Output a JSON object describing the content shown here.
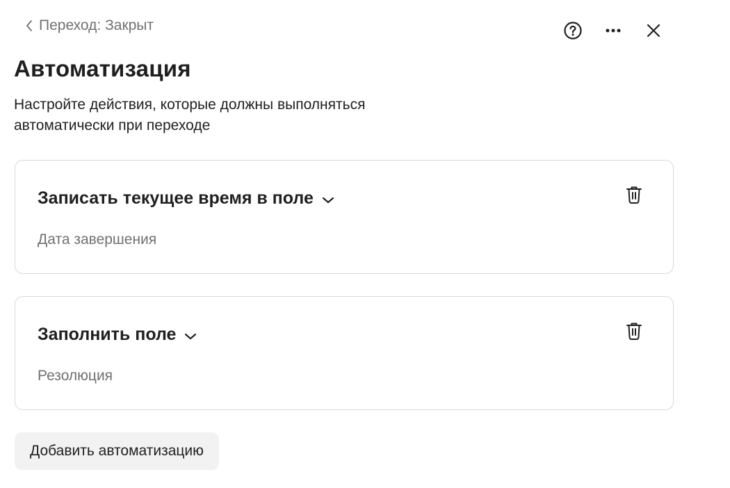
{
  "header": {
    "back_label": "Переход: Закрыт",
    "icons": [
      "chevron-left-icon",
      "help-icon",
      "more-icon",
      "close-icon"
    ]
  },
  "title": "Автоматизация",
  "description": "Настройте действия, которые должны выполняться автоматически при переходе",
  "automations": [
    {
      "action": "Записать текущее время в поле",
      "value": "Дата завершения"
    },
    {
      "action": "Заполнить поле",
      "value": "Резолюция"
    }
  ],
  "add_button_label": "Добавить автоматизацию",
  "colors": {
    "text": "#1f1f1f",
    "muted": "#707070",
    "border": "#d9d9d9",
    "button_bg": "#f2f2f2"
  }
}
